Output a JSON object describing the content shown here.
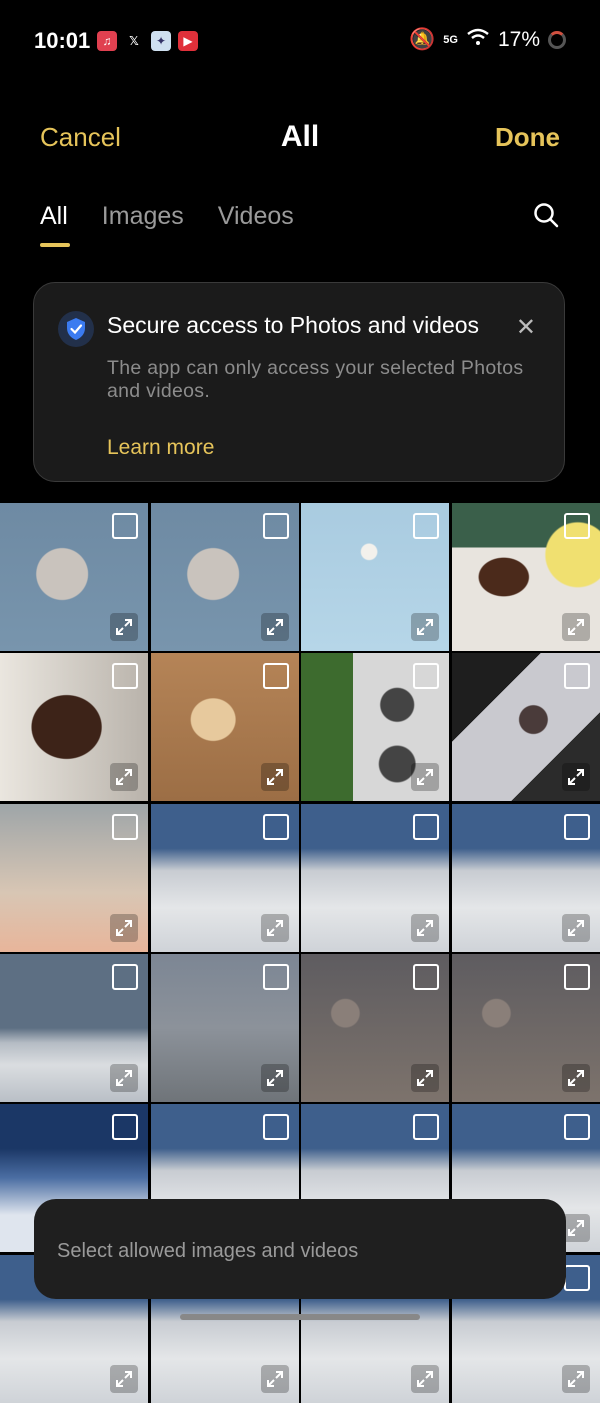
{
  "status": {
    "time": "10:01",
    "network": "5G",
    "battery": "17%",
    "notification_icons": [
      "music-icon",
      "x-icon",
      "app-icon",
      "youtube-icon"
    ]
  },
  "topbar": {
    "cancel": "Cancel",
    "title": "All",
    "done": "Done"
  },
  "tabs": [
    {
      "label": "All",
      "active": true
    },
    {
      "label": "Images",
      "active": false
    },
    {
      "label": "Videos",
      "active": false
    }
  ],
  "secure_card": {
    "title": "Secure access to Photos and videos",
    "text": "The app can only access your selected Photos and videos.",
    "learn_more": "Learn more"
  },
  "bottom_bar": {
    "label": "Select allowed images and videos"
  },
  "colors": {
    "accent": "#e6c45a",
    "background": "#000000"
  },
  "grid": {
    "columns": 4,
    "photos": [
      "moon",
      "moon",
      "sky-moon",
      "cupcake-coffee",
      "cupcake",
      "puppy",
      "phones-plant",
      "phone-headphones",
      "sunset-sky",
      "clouds",
      "clouds",
      "clouds",
      "clouds-horizon",
      "hazy-land",
      "aerial-land",
      "aerial-land",
      "sky-clouds",
      "clouds",
      "clouds",
      "clouds",
      "clouds",
      "clouds",
      "clouds",
      "clouds"
    ]
  }
}
